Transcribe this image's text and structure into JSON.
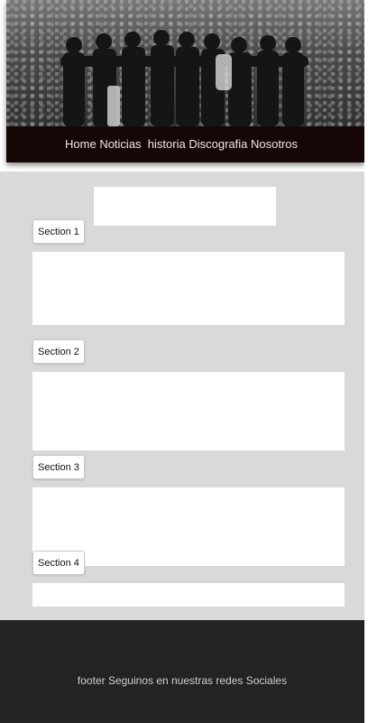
{
  "nav": {
    "items": [
      {
        "label": "Home"
      },
      {
        "label": "Noticias"
      },
      {
        "label": "historia"
      },
      {
        "label": "Discografia"
      },
      {
        "label": "Nosotros"
      }
    ]
  },
  "sections": [
    {
      "label": "Section 1"
    },
    {
      "label": "Section 2"
    },
    {
      "label": "Section 3"
    },
    {
      "label": "Section 4"
    }
  ],
  "footer": {
    "text": "footer Seguinos en nuestras redes Sociales"
  },
  "hero": {
    "image": "band-crowd-photo"
  }
}
